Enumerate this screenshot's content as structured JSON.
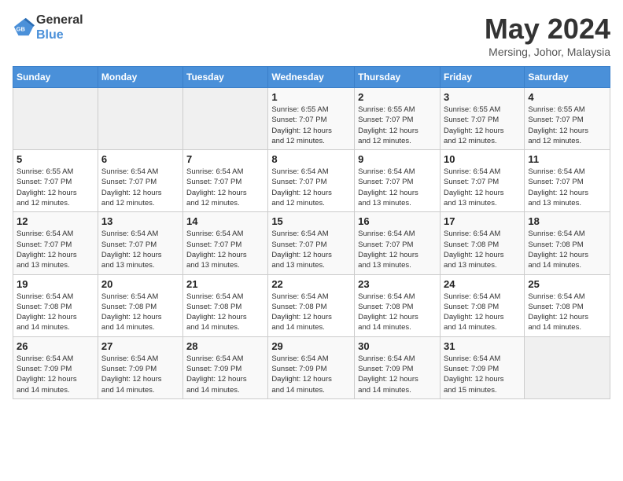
{
  "logo": {
    "line1": "General",
    "line2": "Blue"
  },
  "title": "May 2024",
  "location": "Mersing, Johor, Malaysia",
  "weekdays": [
    "Sunday",
    "Monday",
    "Tuesday",
    "Wednesday",
    "Thursday",
    "Friday",
    "Saturday"
  ],
  "weeks": [
    [
      {
        "day": "",
        "info": ""
      },
      {
        "day": "",
        "info": ""
      },
      {
        "day": "",
        "info": ""
      },
      {
        "day": "1",
        "info": "Sunrise: 6:55 AM\nSunset: 7:07 PM\nDaylight: 12 hours\nand 12 minutes."
      },
      {
        "day": "2",
        "info": "Sunrise: 6:55 AM\nSunset: 7:07 PM\nDaylight: 12 hours\nand 12 minutes."
      },
      {
        "day": "3",
        "info": "Sunrise: 6:55 AM\nSunset: 7:07 PM\nDaylight: 12 hours\nand 12 minutes."
      },
      {
        "day": "4",
        "info": "Sunrise: 6:55 AM\nSunset: 7:07 PM\nDaylight: 12 hours\nand 12 minutes."
      }
    ],
    [
      {
        "day": "5",
        "info": "Sunrise: 6:55 AM\nSunset: 7:07 PM\nDaylight: 12 hours\nand 12 minutes."
      },
      {
        "day": "6",
        "info": "Sunrise: 6:54 AM\nSunset: 7:07 PM\nDaylight: 12 hours\nand 12 minutes."
      },
      {
        "day": "7",
        "info": "Sunrise: 6:54 AM\nSunset: 7:07 PM\nDaylight: 12 hours\nand 12 minutes."
      },
      {
        "day": "8",
        "info": "Sunrise: 6:54 AM\nSunset: 7:07 PM\nDaylight: 12 hours\nand 12 minutes."
      },
      {
        "day": "9",
        "info": "Sunrise: 6:54 AM\nSunset: 7:07 PM\nDaylight: 12 hours\nand 13 minutes."
      },
      {
        "day": "10",
        "info": "Sunrise: 6:54 AM\nSunset: 7:07 PM\nDaylight: 12 hours\nand 13 minutes."
      },
      {
        "day": "11",
        "info": "Sunrise: 6:54 AM\nSunset: 7:07 PM\nDaylight: 12 hours\nand 13 minutes."
      }
    ],
    [
      {
        "day": "12",
        "info": "Sunrise: 6:54 AM\nSunset: 7:07 PM\nDaylight: 12 hours\nand 13 minutes."
      },
      {
        "day": "13",
        "info": "Sunrise: 6:54 AM\nSunset: 7:07 PM\nDaylight: 12 hours\nand 13 minutes."
      },
      {
        "day": "14",
        "info": "Sunrise: 6:54 AM\nSunset: 7:07 PM\nDaylight: 12 hours\nand 13 minutes."
      },
      {
        "day": "15",
        "info": "Sunrise: 6:54 AM\nSunset: 7:07 PM\nDaylight: 12 hours\nand 13 minutes."
      },
      {
        "day": "16",
        "info": "Sunrise: 6:54 AM\nSunset: 7:07 PM\nDaylight: 12 hours\nand 13 minutes."
      },
      {
        "day": "17",
        "info": "Sunrise: 6:54 AM\nSunset: 7:08 PM\nDaylight: 12 hours\nand 13 minutes."
      },
      {
        "day": "18",
        "info": "Sunrise: 6:54 AM\nSunset: 7:08 PM\nDaylight: 12 hours\nand 14 minutes."
      }
    ],
    [
      {
        "day": "19",
        "info": "Sunrise: 6:54 AM\nSunset: 7:08 PM\nDaylight: 12 hours\nand 14 minutes."
      },
      {
        "day": "20",
        "info": "Sunrise: 6:54 AM\nSunset: 7:08 PM\nDaylight: 12 hours\nand 14 minutes."
      },
      {
        "day": "21",
        "info": "Sunrise: 6:54 AM\nSunset: 7:08 PM\nDaylight: 12 hours\nand 14 minutes."
      },
      {
        "day": "22",
        "info": "Sunrise: 6:54 AM\nSunset: 7:08 PM\nDaylight: 12 hours\nand 14 minutes."
      },
      {
        "day": "23",
        "info": "Sunrise: 6:54 AM\nSunset: 7:08 PM\nDaylight: 12 hours\nand 14 minutes."
      },
      {
        "day": "24",
        "info": "Sunrise: 6:54 AM\nSunset: 7:08 PM\nDaylight: 12 hours\nand 14 minutes."
      },
      {
        "day": "25",
        "info": "Sunrise: 6:54 AM\nSunset: 7:08 PM\nDaylight: 12 hours\nand 14 minutes."
      }
    ],
    [
      {
        "day": "26",
        "info": "Sunrise: 6:54 AM\nSunset: 7:09 PM\nDaylight: 12 hours\nand 14 minutes."
      },
      {
        "day": "27",
        "info": "Sunrise: 6:54 AM\nSunset: 7:09 PM\nDaylight: 12 hours\nand 14 minutes."
      },
      {
        "day": "28",
        "info": "Sunrise: 6:54 AM\nSunset: 7:09 PM\nDaylight: 12 hours\nand 14 minutes."
      },
      {
        "day": "29",
        "info": "Sunrise: 6:54 AM\nSunset: 7:09 PM\nDaylight: 12 hours\nand 14 minutes."
      },
      {
        "day": "30",
        "info": "Sunrise: 6:54 AM\nSunset: 7:09 PM\nDaylight: 12 hours\nand 14 minutes."
      },
      {
        "day": "31",
        "info": "Sunrise: 6:54 AM\nSunset: 7:09 PM\nDaylight: 12 hours\nand 15 minutes."
      },
      {
        "day": "",
        "info": ""
      }
    ]
  ]
}
